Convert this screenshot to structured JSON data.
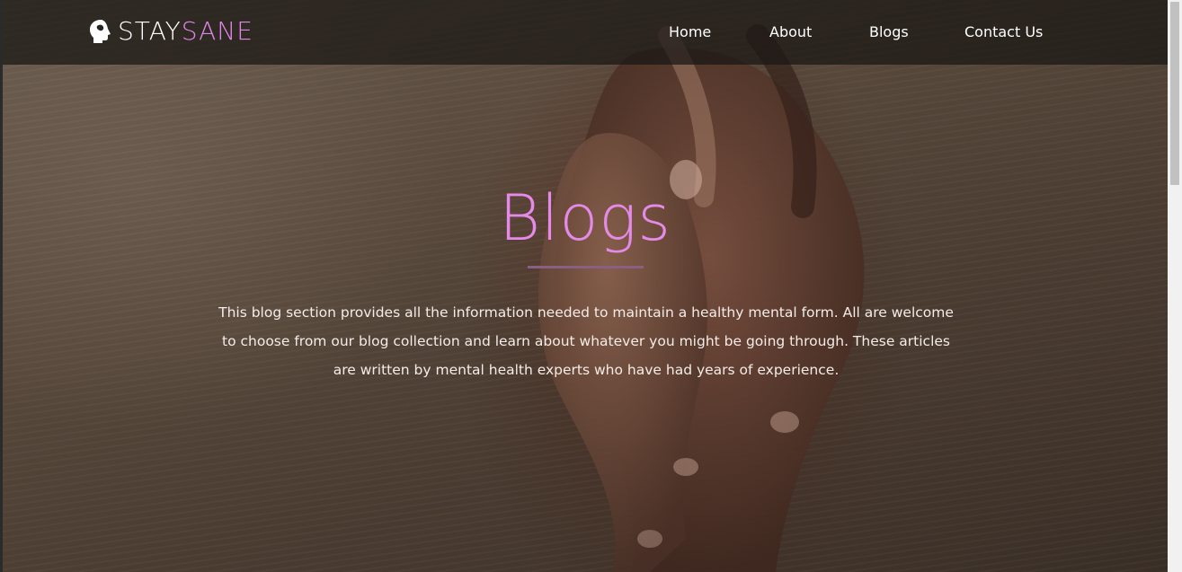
{
  "brand": {
    "icon": "head-profile-icon",
    "name_part1": "STAY",
    "name_part2": "SANE",
    "accent_color": "#dd86e8"
  },
  "nav": {
    "items": [
      {
        "label": "Home"
      },
      {
        "label": "About"
      },
      {
        "label": "Blogs"
      },
      {
        "label": "Contact Us"
      }
    ]
  },
  "hero": {
    "title": "Blogs",
    "title_color": "#e58ae8",
    "description": "This blog section provides all the information needed to maintain a healthy mental form. All are welcome to choose from our blog collection and learn about whatever you might be going through. These articles are written by mental health experts who have had years of experience."
  }
}
